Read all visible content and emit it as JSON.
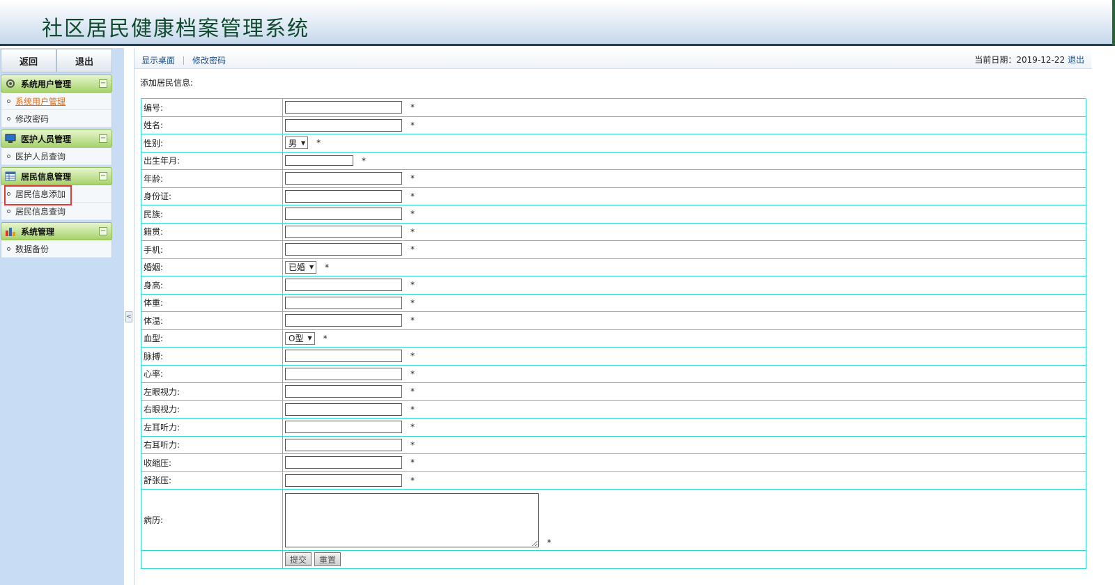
{
  "header": {
    "title": "社区居民健康档案管理系统"
  },
  "sidebar": {
    "top_buttons": {
      "back": "返回",
      "exit": "退出"
    },
    "groups": [
      {
        "label": "系统用户管理",
        "icon": "gear-icon",
        "items": [
          {
            "label": "系统用户管理",
            "active": true
          },
          {
            "label": "修改密码"
          }
        ]
      },
      {
        "label": "医护人员管理",
        "icon": "monitor-icon",
        "items": [
          {
            "label": "医护人员查询"
          }
        ]
      },
      {
        "label": "居民信息管理",
        "icon": "table-icon",
        "items": [
          {
            "label": "居民信息添加",
            "highlighted": true
          },
          {
            "label": "居民信息查询"
          }
        ]
      },
      {
        "label": "系统管理",
        "icon": "bar-chart-icon",
        "items": [
          {
            "label": "数据备份"
          }
        ]
      }
    ],
    "collapse_symbol": "−"
  },
  "topnav": {
    "show_desktop": "显示桌面",
    "change_password": "修改密码",
    "date_label": "当前日期：2019-12-22",
    "logout": "退出"
  },
  "form": {
    "title": "添加居民信息:",
    "required_mark": "*",
    "fields": [
      {
        "label": "编号:",
        "type": "text"
      },
      {
        "label": "姓名:",
        "type": "text"
      },
      {
        "label": "性别:",
        "type": "select",
        "value": "男"
      },
      {
        "label": "出生年月:",
        "type": "date"
      },
      {
        "label": "年龄:",
        "type": "text"
      },
      {
        "label": "身份证:",
        "type": "text"
      },
      {
        "label": "民族:",
        "type": "text"
      },
      {
        "label": "籍贯:",
        "type": "text"
      },
      {
        "label": "手机:",
        "type": "text"
      },
      {
        "label": "婚姻:",
        "type": "select",
        "value": "已婚"
      },
      {
        "label": "身高:",
        "type": "text"
      },
      {
        "label": "体重:",
        "type": "text"
      },
      {
        "label": "体温:",
        "type": "text"
      },
      {
        "label": "血型:",
        "type": "select",
        "value": "O型"
      },
      {
        "label": "脉搏:",
        "type": "text"
      },
      {
        "label": "心率:",
        "type": "text"
      },
      {
        "label": "左眼视力:",
        "type": "text"
      },
      {
        "label": "右眼视力:",
        "type": "text"
      },
      {
        "label": "左耳听力:",
        "type": "text"
      },
      {
        "label": "右耳听力:",
        "type": "text"
      },
      {
        "label": "收缩压:",
        "type": "text"
      },
      {
        "label": "舒张压:",
        "type": "text"
      },
      {
        "label": "病历:",
        "type": "textarea"
      }
    ],
    "submit": "提交",
    "reset": "重置"
  },
  "colors": {
    "table_border": "#33d6d6",
    "active_link": "#e46a16",
    "header_band": "#233f55",
    "group_head": "#a7d36b"
  }
}
